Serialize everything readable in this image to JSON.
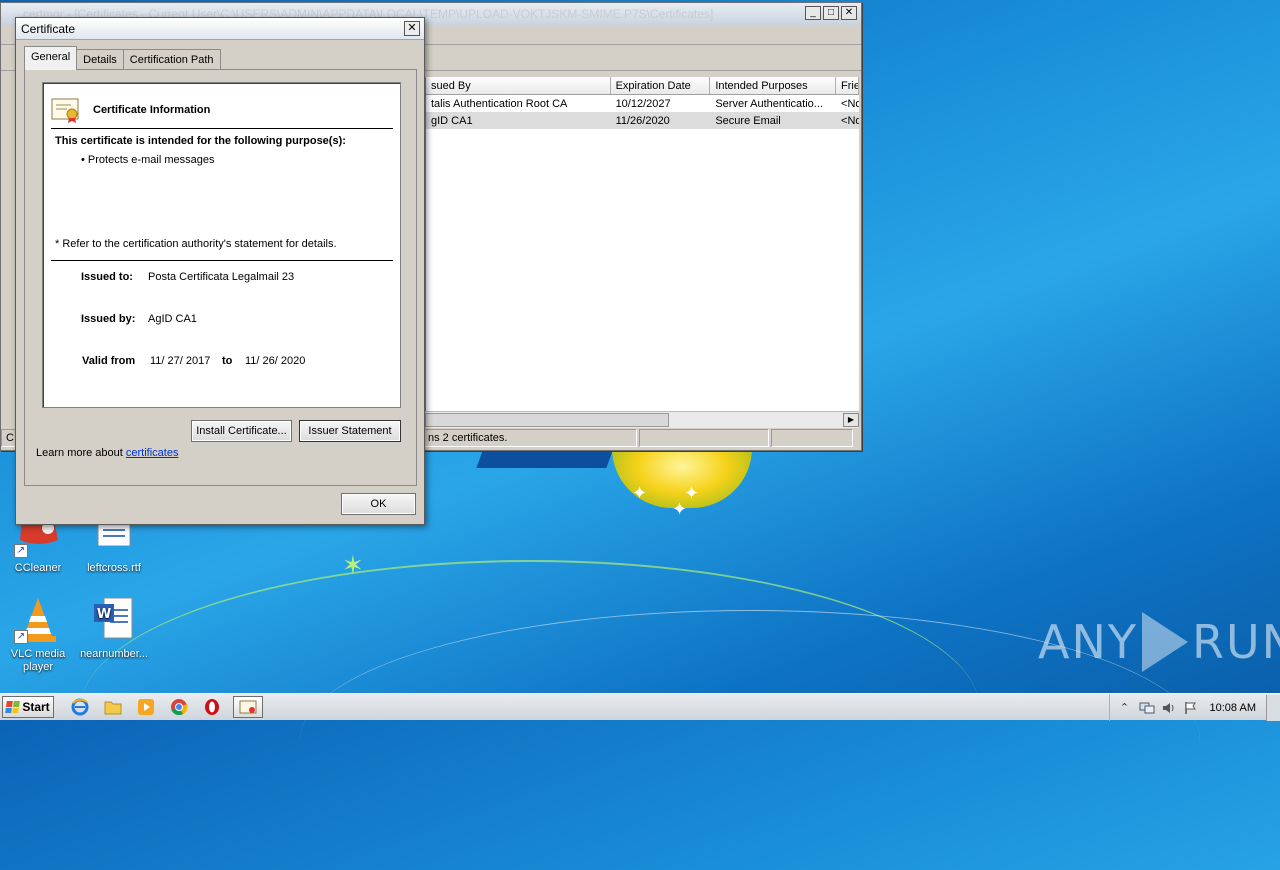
{
  "colors": {
    "link": "#0033cc",
    "desktop_blue": "#1a8fd9",
    "dialog_bg": "#d4d0c8",
    "selection": "#dcdcdc"
  },
  "desktop": {
    "watermark_left": "ANY",
    "watermark_right": "RUN",
    "icons": [
      {
        "label": "CCleaner",
        "icon": "ccleaner-icon"
      },
      {
        "label": "leftcross.rtf",
        "icon": "rtf-document-icon"
      },
      {
        "label": "VLC media player",
        "icon": "vlc-cone-icon"
      },
      {
        "label": "nearnumber...",
        "icon": "word-document-icon"
      }
    ]
  },
  "certmgr": {
    "title": "certmgr - [Certificates - Current User\\C:\\USERS\\ADMIN\\APPDATA\\LOCAL\\TEMP\\UPLOAD-VOKTJSKM-SMIME.P7S\\Certificates]",
    "columns": [
      "sued By",
      "Expiration Date",
      "Intended Purposes",
      "Frie"
    ],
    "rows": [
      {
        "issued_by": "talis Authentication Root CA",
        "expiration": "10/12/2027",
        "purposes": "Server Authenticatio...",
        "friendly": "<No"
      },
      {
        "issued_by": "gID CA1",
        "expiration": "11/26/2020",
        "purposes": "Secure Email",
        "friendly": "<No"
      }
    ],
    "status": "ns 2 certificates.",
    "status_left": "C:"
  },
  "dialog": {
    "title": "Certificate",
    "tabs": [
      "General",
      "Details",
      "Certification Path"
    ],
    "info_title": "Certificate Information",
    "purpose_heading": "This certificate is intended for the following purpose(s):",
    "purpose": "• Protects e-mail messages",
    "refer_note": "* Refer to the certification authority's statement for details.",
    "issued_to_label": "Issued to:",
    "issued_to": "Posta Certificata Legalmail 23",
    "issued_by_label": "Issued by:",
    "issued_by": "AgID CA1",
    "valid_from_label": "Valid from",
    "valid_from": "11/ 27/ 2017",
    "to_label": "to",
    "valid_to": "11/ 26/ 2020",
    "install_button": "Install Certificate...",
    "issuer_button": "Issuer Statement",
    "learn_prefix": "Learn more about ",
    "learn_link": "certificates",
    "ok_button": "OK"
  },
  "taskbar": {
    "start_label": "Start",
    "clock": "10:08 AM"
  }
}
